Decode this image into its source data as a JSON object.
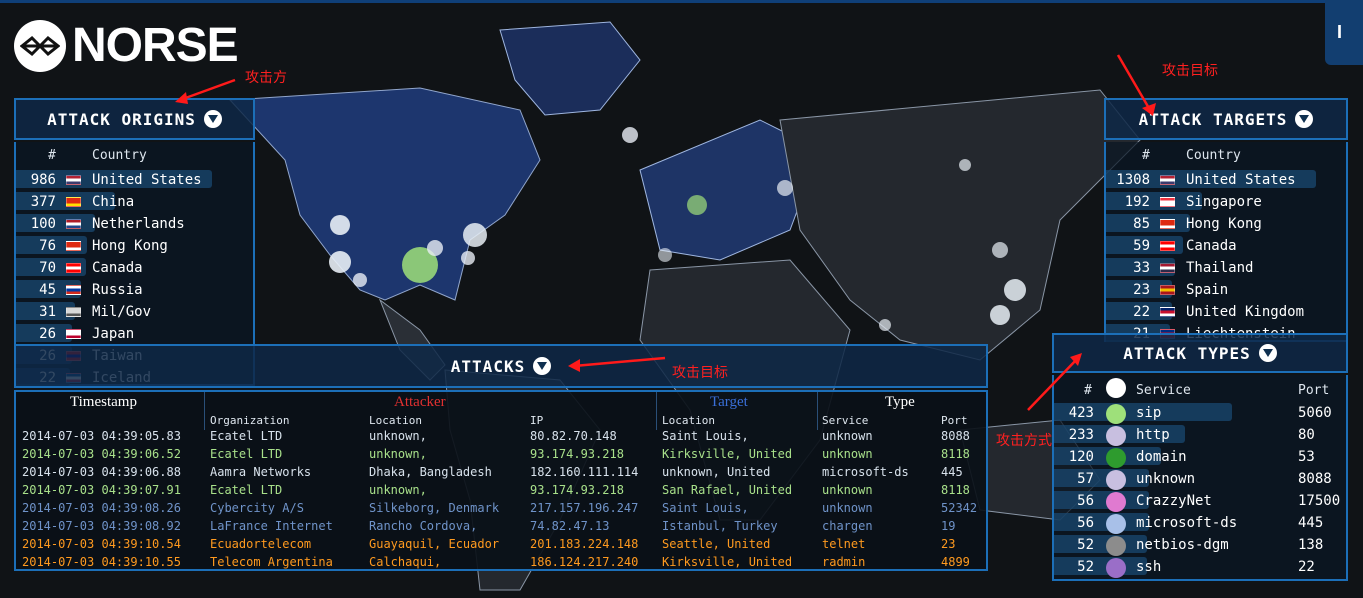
{
  "brand": {
    "name": "NORSE"
  },
  "corner_tab": {
    "label": "I"
  },
  "origins": {
    "title": "ATTACK ORIGINS",
    "col_num": "#",
    "col_country": "Country",
    "rows": [
      {
        "count": "986",
        "country": "United States",
        "flag": "us-flag"
      },
      {
        "count": "377",
        "country": "China",
        "flag": "cn-flag"
      },
      {
        "count": "100",
        "country": "Netherlands",
        "flag": "nl-flag"
      },
      {
        "count": "76",
        "country": "Hong Kong",
        "flag": "hk-flag"
      },
      {
        "count": "70",
        "country": "Canada",
        "flag": "ca-flag"
      },
      {
        "count": "45",
        "country": "Russia",
        "flag": "ru-flag"
      },
      {
        "count": "31",
        "country": "Mil/Gov",
        "flag": "mil-flag"
      },
      {
        "count": "26",
        "country": "Japan",
        "flag": "jp-flag"
      },
      {
        "count": "26",
        "country": "Taiwan",
        "flag": "tw-flag"
      },
      {
        "count": "22",
        "country": "Iceland",
        "flag": "is-flag"
      }
    ],
    "bar_fracs": [
      1.0,
      0.38,
      0.25,
      0.2,
      0.19,
      0.16,
      0.12,
      0.1,
      0.1,
      0.09
    ]
  },
  "targets": {
    "title": "ATTACK TARGETS",
    "col_num": "#",
    "col_country": "Country",
    "rows": [
      {
        "count": "1308",
        "country": "United States",
        "flag": "us-flag"
      },
      {
        "count": "192",
        "country": "Singapore",
        "flag": "sg-flag"
      },
      {
        "count": "85",
        "country": "Hong Kong",
        "flag": "hk-flag"
      },
      {
        "count": "59",
        "country": "Canada",
        "flag": "ca-flag"
      },
      {
        "count": "33",
        "country": "Thailand",
        "flag": "th-flag"
      },
      {
        "count": "23",
        "country": "Spain",
        "flag": "es-flag"
      },
      {
        "count": "22",
        "country": "United Kingdom",
        "flag": "gb-flag"
      },
      {
        "count": "21",
        "country": "Liechtenstein",
        "flag": "li-flag"
      }
    ],
    "bar_fracs": [
      1.0,
      0.33,
      0.26,
      0.22,
      0.17,
      0.15,
      0.15,
      0.14
    ]
  },
  "attacks": {
    "title": "ATTACKS",
    "headers": {
      "timestamp": "Timestamp",
      "attacker": "Attacker",
      "target": "Target",
      "type": "Type",
      "organization": "Organization",
      "location": "Location",
      "ip": "IP",
      "target_location": "Location",
      "service": "Service",
      "port": "Port"
    },
    "rows": [
      {
        "ts": "2014-07-03 04:39:05.83",
        "org": "Ecatel LTD",
        "loc": "unknown,",
        "ip": "80.82.70.148",
        "tloc": "Saint Louis,",
        "svc": "unknown",
        "port": "8088",
        "color": "#d8e2ec"
      },
      {
        "ts": "2014-07-03 04:39:06.52",
        "org": "Ecatel LTD",
        "loc": "unknown,",
        "ip": "93.174.93.218",
        "tloc": "Kirksville, United",
        "svc": "unknown",
        "port": "8118",
        "color": "#a8e08a"
      },
      {
        "ts": "2014-07-03 04:39:06.88",
        "org": "Aamra Networks",
        "loc": "Dhaka, Bangladesh",
        "ip": "182.160.111.114",
        "tloc": "unknown, United",
        "svc": "microsoft-ds",
        "port": "445",
        "color": "#d8e2ec"
      },
      {
        "ts": "2014-07-03 04:39:07.91",
        "org": "Ecatel LTD",
        "loc": "unknown,",
        "ip": "93.174.93.218",
        "tloc": "San Rafael, United",
        "svc": "unknown",
        "port": "8118",
        "color": "#a8e08a"
      },
      {
        "ts": "2014-07-03 04:39:08.26",
        "org": "Cybercity A/S",
        "loc": "Silkeborg, Denmark",
        "ip": "217.157.196.247",
        "tloc": "Saint Louis,",
        "svc": "unknown",
        "port": "52342",
        "color": "#6f93c9"
      },
      {
        "ts": "2014-07-03 04:39:08.92",
        "org": "LaFrance Internet",
        "loc": "Rancho Cordova,",
        "ip": "74.82.47.13",
        "tloc": "Istanbul, Turkey",
        "svc": "chargen",
        "port": "19",
        "color": "#6f93c9"
      },
      {
        "ts": "2014-07-03 04:39:10.54",
        "org": "Ecuadortelecom",
        "loc": "Guayaquil, Ecuador",
        "ip": "201.183.224.148",
        "tloc": "Seattle, United",
        "svc": "telnet",
        "port": "23",
        "color": "#ff9a1f"
      },
      {
        "ts": "2014-07-03 04:39:10.55",
        "org": "Telecom Argentina",
        "loc": "Calchaqui,",
        "ip": "186.124.217.240",
        "tloc": "Kirksville, United",
        "svc": "radmin",
        "port": "4899",
        "color": "#ff9a1f"
      }
    ]
  },
  "types": {
    "title": "ATTACK TYPES",
    "col_num": "#",
    "col_service": "Service",
    "col_port": "Port",
    "rows": [
      {
        "count": "423",
        "service": "sip",
        "port": "5060",
        "color": "#9ee07a"
      },
      {
        "count": "233",
        "service": "http",
        "port": "80",
        "color": "#c8bfe0"
      },
      {
        "count": "120",
        "service": "domain",
        "port": "53",
        "color": "#2e9b2e"
      },
      {
        "count": "57",
        "service": "unknown",
        "port": "8088",
        "color": "#c8bfe0"
      },
      {
        "count": "56",
        "service": "CrazzyNet",
        "port": "17500",
        "color": "#e07ad0"
      },
      {
        "count": "56",
        "service": "microsoft-ds",
        "port": "445",
        "color": "#a8c0e8"
      },
      {
        "count": "52",
        "service": "netbios-dgm",
        "port": "138",
        "color": "#8c8c8c"
      },
      {
        "count": "52",
        "service": "ssh",
        "port": "22",
        "color": "#9a6ec8"
      }
    ],
    "bar_fracs": [
      1.0,
      0.6,
      0.4,
      0.3,
      0.3,
      0.3,
      0.28,
      0.28
    ]
  },
  "annotations": {
    "origins": "攻击方",
    "targets": "攻击目标",
    "attacks": "攻击目标",
    "types": "攻击方式"
  }
}
